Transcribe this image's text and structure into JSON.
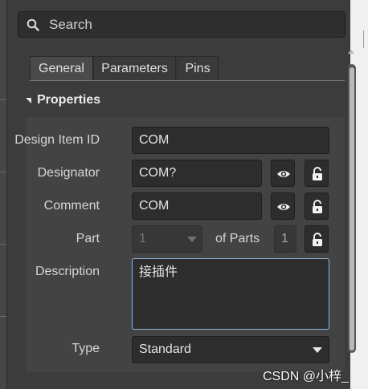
{
  "search": {
    "placeholder": "Search"
  },
  "tabs": [
    {
      "label": "General",
      "active": true
    },
    {
      "label": "Parameters",
      "active": false
    },
    {
      "label": "Pins",
      "active": false
    }
  ],
  "section": {
    "title": "Properties"
  },
  "fields": {
    "design_item_id": {
      "label": "Design Item ID",
      "value": "COM"
    },
    "designator": {
      "label": "Designator",
      "value": "COM?"
    },
    "comment": {
      "label": "Comment",
      "value": "COM"
    },
    "part": {
      "label": "Part",
      "value": "1",
      "of_label": "of Parts",
      "of_value": "1"
    },
    "description": {
      "label": "Description",
      "value": "接插件"
    },
    "type": {
      "label": "Type",
      "value": "Standard"
    }
  },
  "icons": [
    "search-icon",
    "eye-icon",
    "lock-icon",
    "chevron-down-icon",
    "collapse-triangle-icon"
  ],
  "watermark": "CSDN @小梓_"
}
